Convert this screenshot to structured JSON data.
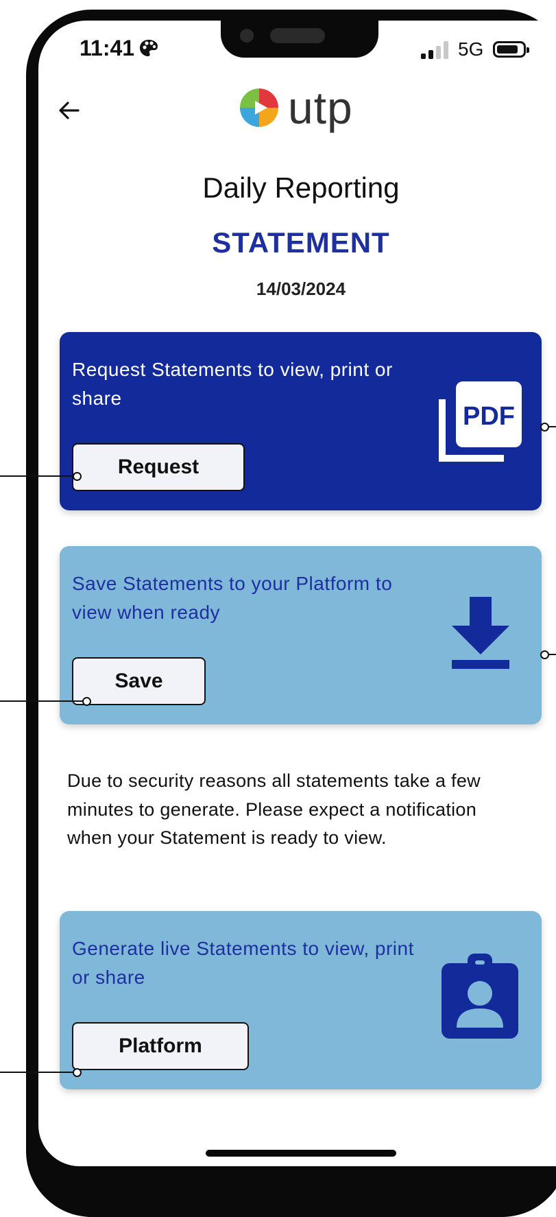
{
  "status_bar": {
    "time": "11:41",
    "network": "5G",
    "signal_bars_active": 2,
    "battery_fraction": 0.7
  },
  "header": {
    "back_icon": "arrow-left-icon",
    "logo_text": "utp",
    "logo_colors": [
      "#e2373c",
      "#f3a51b",
      "#3aa6dd",
      "#7ac043"
    ]
  },
  "page": {
    "title": "Daily Reporting",
    "subtitle": "STATEMENT",
    "date": "14/03/2024"
  },
  "cards": [
    {
      "text": "Request Statements to view, print or share",
      "button_label": "Request",
      "icon": "pdf-icon",
      "icon_text": "PDF",
      "style": "dark",
      "background": "#132a9a"
    },
    {
      "text": "Save Statements to your Platform to view when ready",
      "button_label": "Save",
      "icon": "download-icon",
      "style": "light",
      "background": "#80b8d9"
    },
    {
      "text": "Generate live Statements to view, print or share",
      "button_label": "Platform",
      "icon": "id-badge-icon",
      "style": "light",
      "background": "#80b8d9"
    }
  ],
  "notice": "Due to security reasons all statements take a few minutes to generate. Please expect a notification when your Statement is ready to view.",
  "colors": {
    "brand_blue": "#1e2fa0",
    "dark_card": "#132a9a",
    "light_card": "#80b8d9",
    "button_bg": "#f2f3f8"
  }
}
